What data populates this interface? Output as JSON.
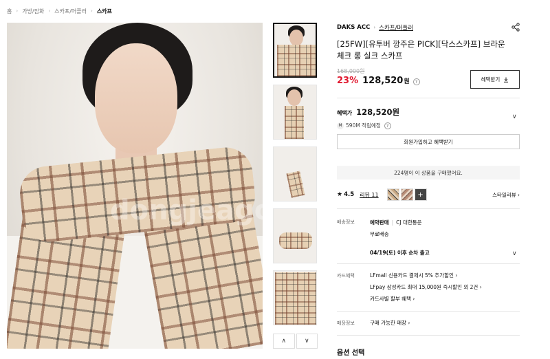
{
  "breadcrumb": [
    "홈",
    "가방/잡화",
    "스카프/머플러",
    "스카프"
  ],
  "images": {
    "watermark": "dongjeago",
    "thumb_up": "∧",
    "thumb_down": "∨"
  },
  "product": {
    "brand": "DAKS ACC",
    "category": "스카프/머플러",
    "title": "[25FW][유투버 깡주은 PICK][닥스스카프] 브라운 체크 롱 실크 스카프",
    "original_price": "168,000원",
    "discount": "23%",
    "price": "128,520",
    "price_unit": "원",
    "coupon_button": "혜택받기",
    "qmark": "?"
  },
  "benefit": {
    "label": "혜택가",
    "price": "128,520원",
    "points_badge": "M",
    "points": "590M 적립예정",
    "join_button": "회원가입하고 혜택받기"
  },
  "buyers_text": "224명이 이 상품을 구매했어요.",
  "review": {
    "star": "★",
    "rating": "4.5",
    "count_label": "리뷰 11",
    "more_icon": "+",
    "style_review": "스타일리뷰 ›"
  },
  "shipping": {
    "label": "배송정보",
    "type": "예약판매",
    "carrier": "CJ 대한통운",
    "fee": "무료배송",
    "date": "04/19(토) 이후 순차 출고"
  },
  "card": {
    "label": "카드혜택",
    "items": [
      "LFmall 신용카드 결제시 5% 추가할인 ›",
      "LFpay 삼성카드 최대 15,000원 즉시할인 외 2건 ›",
      "카드사별 할부 혜택 ›"
    ]
  },
  "store": {
    "label": "매장정보",
    "text": "구매 가능한 매장 ›"
  },
  "options_title": "옵션 선택"
}
